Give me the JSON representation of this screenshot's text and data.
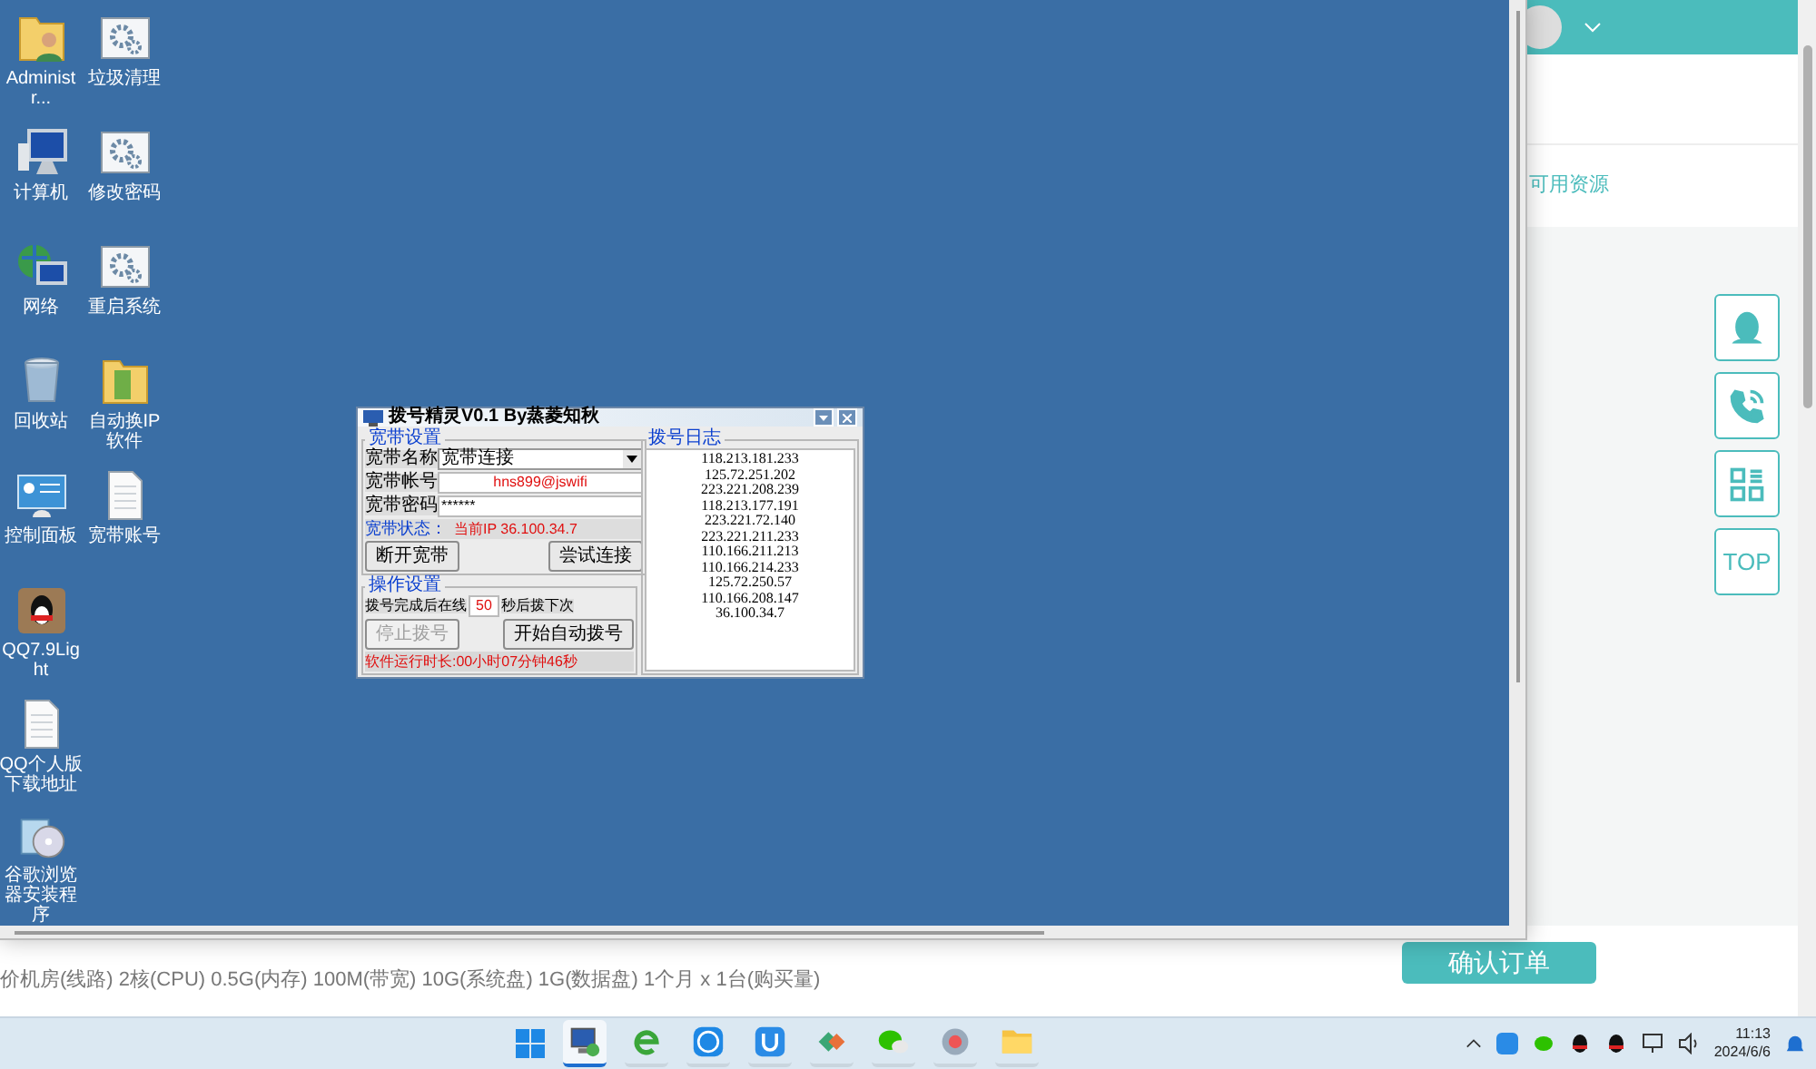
{
  "web_page": {
    "resources_link": "可用资源",
    "spec_text": "价机房(线路) 2核(CPU) 0.5G(内存) 100M(带宽) 10G(系统盘) 1G(数据盘) 1个月 x 1台(购买量)",
    "confirm_button": "确认订单",
    "float_buttons": [
      {
        "kind": "qq"
      },
      {
        "kind": "phone"
      },
      {
        "kind": "qr"
      },
      {
        "kind": "text",
        "label": "TOP"
      }
    ]
  },
  "desktop_icons": [
    {
      "label": "Administr...",
      "kind": "user-folder"
    },
    {
      "label": "垃圾清理",
      "kind": "gear-window"
    },
    {
      "label": "计算机",
      "kind": "computer"
    },
    {
      "label": "修改密码",
      "kind": "gear-window"
    },
    {
      "label": "网络",
      "kind": "network"
    },
    {
      "label": "重启系统",
      "kind": "gear-window"
    },
    {
      "label": "回收站",
      "kind": "recycle-bin"
    },
    {
      "label": "自动换IP软件",
      "kind": "folder"
    },
    {
      "label": "控制面板",
      "kind": "control-panel"
    },
    {
      "label": "宽带账号",
      "kind": "document"
    },
    {
      "label": "QQ7.9Light",
      "kind": "qq"
    },
    {
      "kind": "none"
    },
    {
      "label": "QQ个人版下载地址",
      "kind": "document"
    },
    {
      "kind": "none"
    },
    {
      "label": "谷歌浏览器安装程序",
      "kind": "installer"
    }
  ],
  "dialog": {
    "title": "拨号精灵V0.1 By蒸菱知秋",
    "broadband": {
      "legend": "宽带设置",
      "name_label": "宽带名称",
      "name_value": "宽带连接",
      "account_label": "宽带帐号",
      "account_value": "hns899@jswifi",
      "password_label": "宽带密码",
      "password_value": "******",
      "status_label": "宽带状态：",
      "status_value": "当前IP 36.100.34.7",
      "buttons": [
        {
          "label": "断开宽带",
          "disabled": false
        },
        {
          "label": "尝试连接",
          "disabled": false
        }
      ]
    },
    "operation": {
      "legend": "操作设置",
      "before_label": "拨号完成后在线",
      "seconds": "50",
      "after_label": "秒后拨下次",
      "buttons": [
        {
          "label": "停止拨号",
          "disabled": true
        },
        {
          "label": "开始自动拨号",
          "disabled": false
        }
      ],
      "runtime": "软件运行时长:00小时07分钟46秒"
    },
    "log": {
      "legend": "拨号日志",
      "entries": [
        "118.213.181.233",
        "125.72.251.202",
        "223.221.208.239",
        "118.213.177.191",
        "223.221.72.140",
        "223.221.211.233",
        "110.166.211.213",
        "110.166.214.233",
        "125.72.250.57",
        "110.166.208.147",
        "36.100.34.7"
      ]
    }
  },
  "taskbar": {
    "apps": [
      {
        "kind": "remote-desktop",
        "selected": true
      },
      {
        "kind": "ie",
        "selected": false
      },
      {
        "kind": "k-app",
        "selected": false
      },
      {
        "kind": "u-app",
        "selected": false
      },
      {
        "kind": "diamond",
        "selected": false
      },
      {
        "kind": "wechat",
        "selected": false
      },
      {
        "kind": "globe",
        "selected": false
      },
      {
        "kind": "folder",
        "selected": false
      }
    ],
    "time": "11:13",
    "date": "2024/6/6"
  }
}
